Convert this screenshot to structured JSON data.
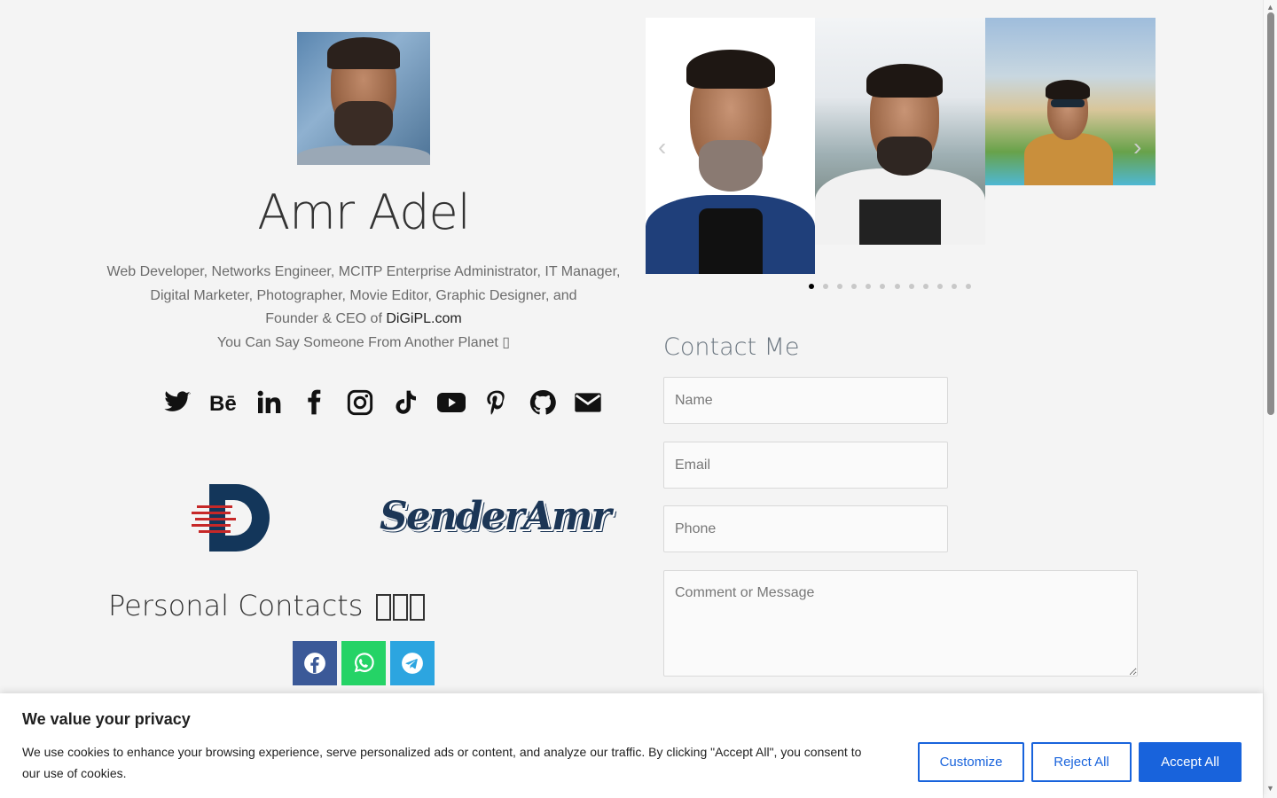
{
  "profile": {
    "name": "Amr Adel",
    "bio_line1": "Web Developer, Networks Engineer, MCITP Enterprise Administrator, IT Manager,",
    "bio_line2": "Digital Marketer, Photographer, Movie Editor, Graphic Designer, and",
    "bio_line3_prefix": "Founder & CEO of",
    "bio_link": "DiGiPL.com",
    "bio_line4": "You Can Say Someone From Another Planet ▯"
  },
  "socials": [
    "twitter-icon",
    "behance-icon",
    "linkedin-icon",
    "facebook-icon",
    "instagram-icon",
    "tiktok-icon",
    "youtube-icon",
    "pinterest-icon",
    "github-icon",
    "email-icon"
  ],
  "logos": {
    "sender_text": "SenderAmr"
  },
  "personal_contacts": {
    "title": "Personal Contacts",
    "buttons": [
      {
        "icon": "facebook-icon",
        "color": "#3b5998"
      },
      {
        "icon": "whatsapp-icon",
        "color": "#25d366"
      },
      {
        "icon": "telegram-icon",
        "color": "#2ca5e0"
      }
    ]
  },
  "carousel": {
    "dot_count": 12,
    "active_index": 0
  },
  "contact_form": {
    "title": "Contact Me",
    "name_placeholder": "Name",
    "email_placeholder": "Email",
    "phone_placeholder": "Phone",
    "message_placeholder": "Comment or Message"
  },
  "cookie_banner": {
    "title": "We value your privacy",
    "text": "We use cookies to enhance your browsing experience, serve personalized ads or content, and analyze our traffic. By clicking \"Accept All\", you consent to our use of cookies.",
    "customize_label": "Customize",
    "reject_label": "Reject All",
    "accept_label": "Accept All",
    "accent_color": "#1863dc"
  }
}
